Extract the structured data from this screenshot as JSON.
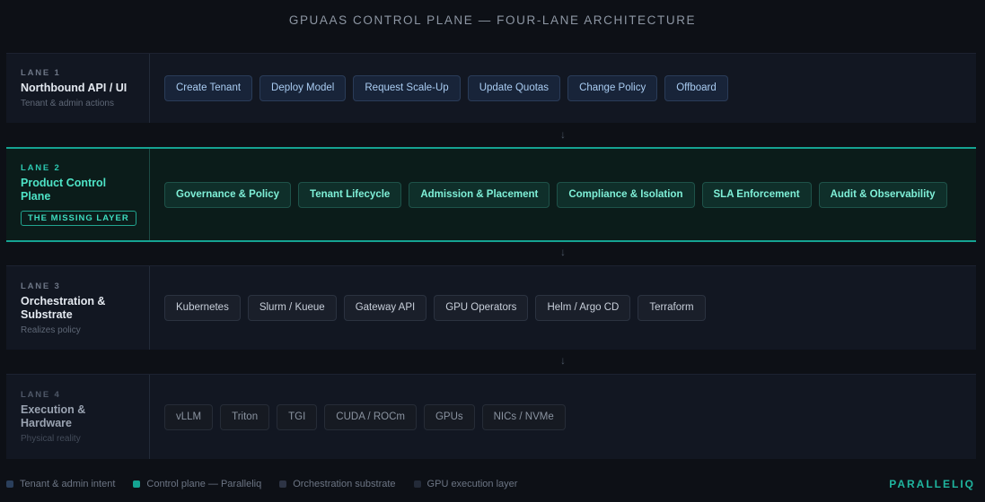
{
  "title": "GPUAAS CONTROL PLANE — FOUR-LANE ARCHITECTURE",
  "connector_glyph": "↓",
  "lanes": [
    {
      "number": "LANE 1",
      "name": "Northbound API / UI",
      "subtitle": "Tenant & admin actions",
      "items": [
        "Create Tenant",
        "Deploy Model",
        "Request Scale-Up",
        "Update Quotas",
        "Change Policy",
        "Offboard"
      ]
    },
    {
      "number": "LANE 2",
      "name": "Product Control Plane",
      "tag": "THE MISSING LAYER",
      "items": [
        "Governance & Policy",
        "Tenant Lifecycle",
        "Admission & Placement",
        "Compliance & Isolation",
        "SLA Enforcement",
        "Audit & Observability"
      ]
    },
    {
      "number": "LANE 3",
      "name": "Orchestration & Substrate",
      "subtitle": "Realizes policy",
      "items": [
        "Kubernetes",
        "Slurm / Kueue",
        "Gateway API",
        "GPU Operators",
        "Helm / Argo CD",
        "Terraform"
      ]
    },
    {
      "number": "LANE 4",
      "name": "Execution & Hardware",
      "subtitle": "Physical reality",
      "items": [
        "vLLM",
        "Triton",
        "TGI",
        "CUDA / ROCm",
        "GPUs",
        "NICs / NVMe"
      ]
    }
  ],
  "legend": [
    {
      "label": "Tenant & admin intent",
      "color": "#2a3f5c"
    },
    {
      "label": "Control plane — Paralleliq",
      "color": "#15a392"
    },
    {
      "label": "Orchestration substrate",
      "color": "#2d3445"
    },
    {
      "label": "GPU execution layer",
      "color": "#232a38"
    }
  ],
  "brand": "PARALLELIQ",
  "colors": {
    "accent": "#15a392",
    "background": "#0d1016",
    "lane_background": "#121722"
  }
}
